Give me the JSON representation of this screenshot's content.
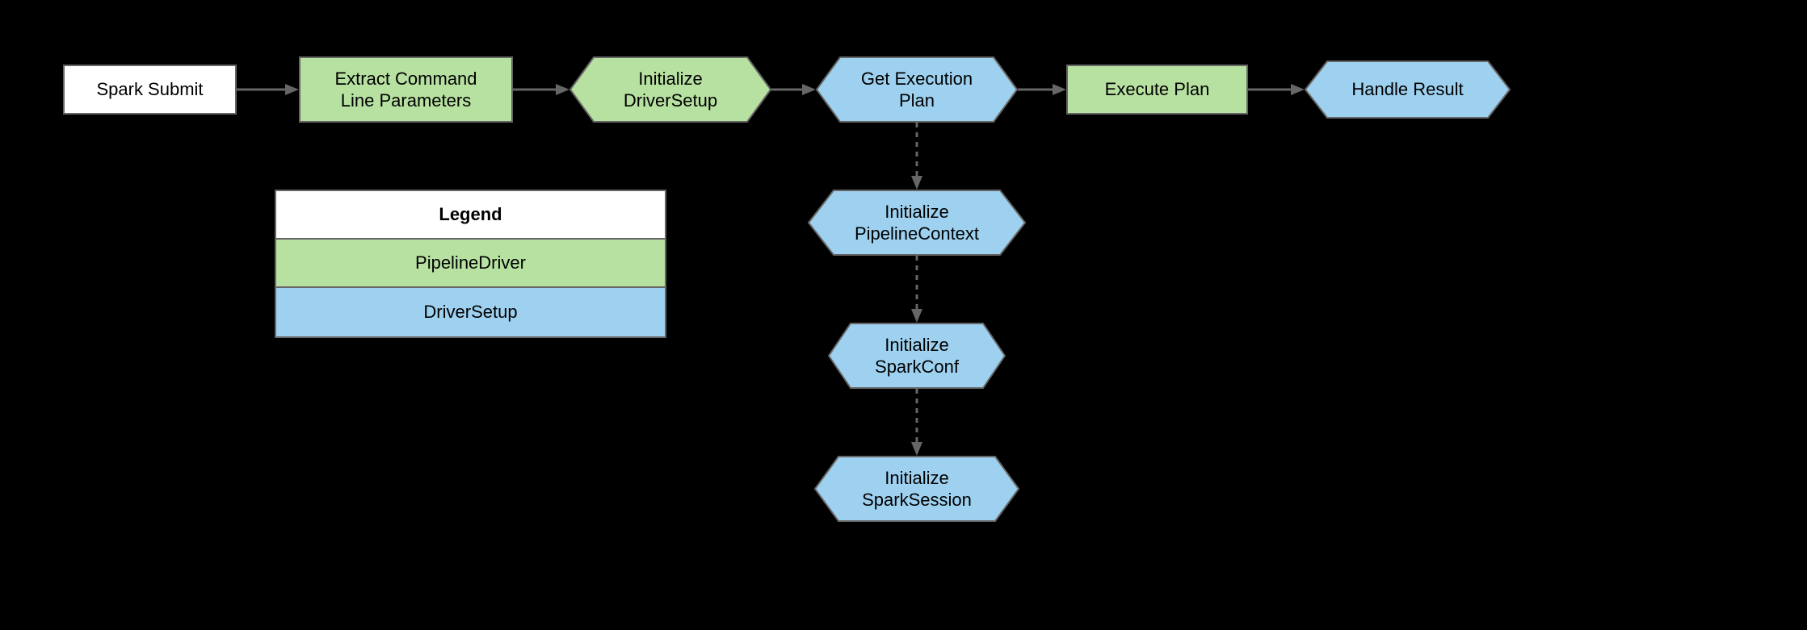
{
  "nodes": {
    "sparkSubmit": "Spark Submit",
    "extractParams": "Extract Command\nLine Parameters",
    "initDriverSetup": "Initialize\nDriverSetup",
    "getExecPlan": "Get Execution\nPlan",
    "executePlan": "Execute Plan",
    "handleResult": "Handle Result",
    "initPipelineContext": "Initialize\nPipelineContext",
    "initSparkConf": "Initialize\nSparkConf",
    "initSparkSession": "Initialize\nSparkSession"
  },
  "legend": {
    "title": "Legend",
    "pipelineDriver": "PipelineDriver",
    "driverSetup": "DriverSetup"
  },
  "colors": {
    "green": "#b7e1a1",
    "blue": "#9ed1f0",
    "border": "#666666"
  }
}
